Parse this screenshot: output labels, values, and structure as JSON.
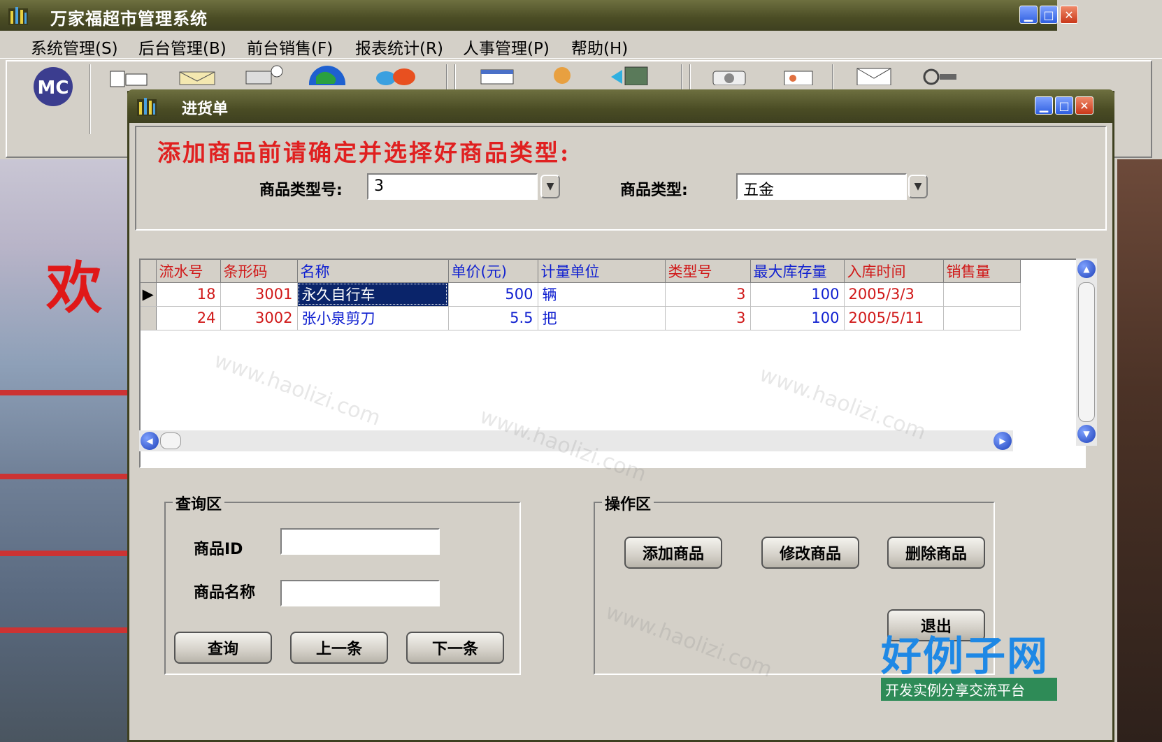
{
  "main_window": {
    "title": "万家福超市管理系统",
    "menu": [
      "系统管理(S)",
      "后台管理(B)",
      "前台销售(F)",
      "报表统计(R)",
      "人事管理(P)",
      "帮助(H)"
    ],
    "toolbar_logo": "MC",
    "background_text": "欢"
  },
  "child_window": {
    "title": "进货单",
    "warning": "添加商品前请确定并选择好商品类型:",
    "type_no_label": "商品类型号:",
    "type_no_value": "3",
    "type_label": "商品类型:",
    "type_value": "五金"
  },
  "grid": {
    "columns": [
      {
        "label": "流水号",
        "color": "red"
      },
      {
        "label": "条形码",
        "color": "red"
      },
      {
        "label": "名称",
        "color": "blue"
      },
      {
        "label": "单价(元)",
        "color": "blue"
      },
      {
        "label": "计量单位",
        "color": "blue"
      },
      {
        "label": "类型号",
        "color": "red"
      },
      {
        "label": "最大库存量",
        "color": "blue"
      },
      {
        "label": "入库时间",
        "color": "red"
      },
      {
        "label": "销售量",
        "color": "red"
      }
    ],
    "rows": [
      [
        "18",
        "3001",
        "永久自行车",
        "500",
        "辆",
        "3",
        "100",
        "2005/3/3",
        ""
      ],
      [
        "24",
        "3002",
        "张小泉剪刀",
        "5.5",
        "把",
        "3",
        "100",
        "2005/5/11",
        ""
      ]
    ]
  },
  "query": {
    "group_title": "查询区",
    "id_label": "商品ID",
    "name_label": "商品名称",
    "id_value": "",
    "name_value": "",
    "search_btn": "查询",
    "prev_btn": "上一条",
    "next_btn": "下一条"
  },
  "operation": {
    "group_title": "操作区",
    "add_btn": "添加商品",
    "edit_btn": "修改商品",
    "delete_btn": "删除商品",
    "exit_btn": "退出"
  },
  "watermark": "www.haolizi.com",
  "corner_logo": {
    "title": "好例子网",
    "subtitle": "开发实例分享交流平台"
  },
  "colors": {
    "titlebar": "#4a4c24",
    "warning": "#e02020",
    "grid_red": "#d01818",
    "grid_blue": "#1020d0",
    "selection": "#0a246a"
  }
}
